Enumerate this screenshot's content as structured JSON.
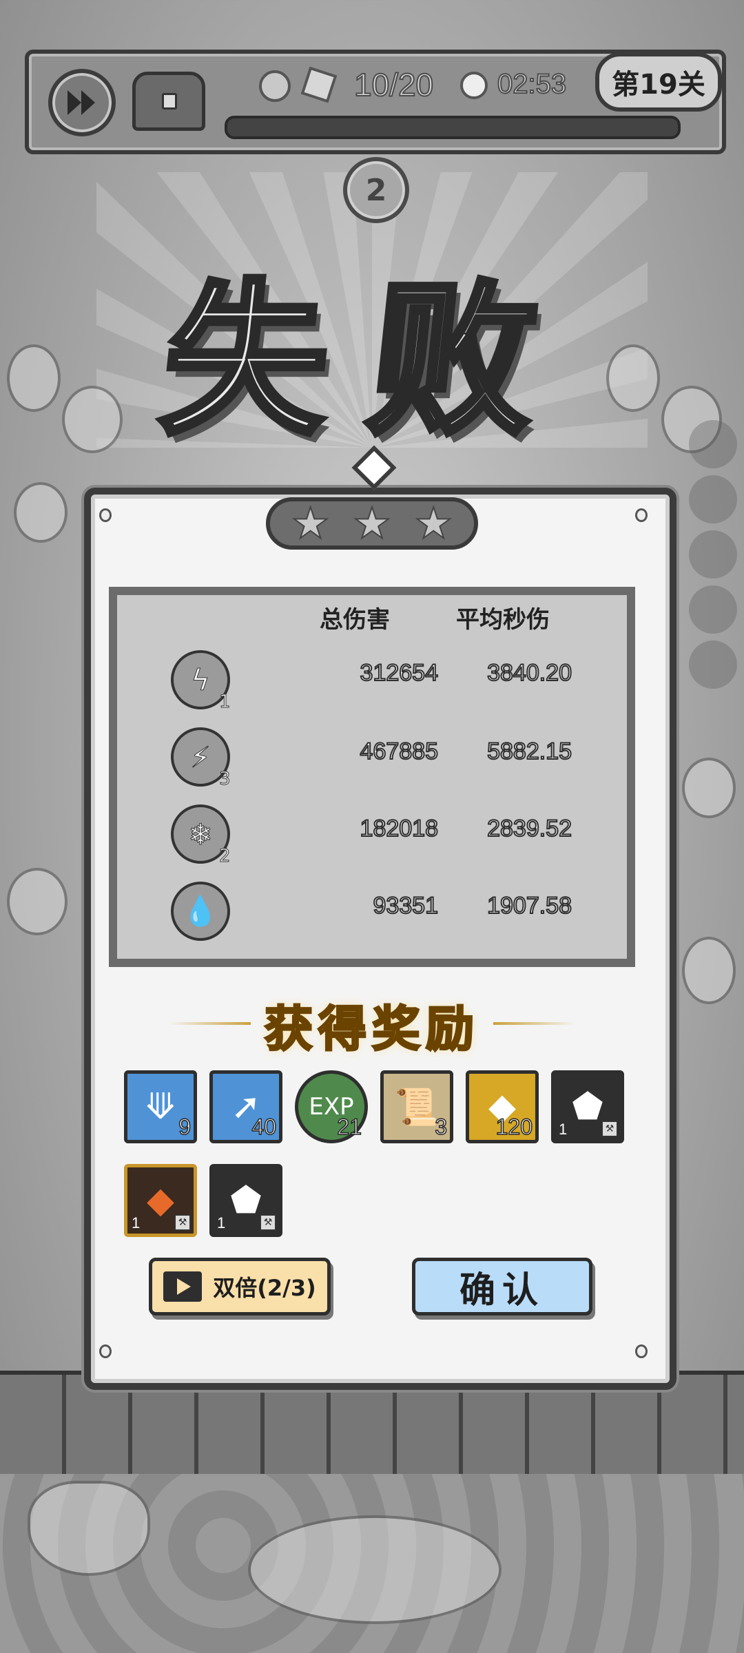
{
  "hud": {
    "resource_count": "10/20",
    "timer": "02:53",
    "stage_label": "第19关",
    "wave_number": "2",
    "progress": 0.0
  },
  "result": {
    "title": "失败",
    "stars_earned": 0,
    "stars_total": 3
  },
  "stats": {
    "header_total": "总伤害",
    "header_dps": "平均秒伤",
    "rows": [
      {
        "icon": "lightning-strike-icon",
        "level": "1",
        "total": "312654",
        "dps": "3840.20"
      },
      {
        "icon": "chain-lightning-icon",
        "level": "3",
        "total": "467885",
        "dps": "5882.15"
      },
      {
        "icon": "ice-crystal-icon",
        "level": "2",
        "total": "182018",
        "dps": "2839.52"
      },
      {
        "icon": "poison-drop-icon",
        "level": "",
        "total": "93351",
        "dps": "1907.58"
      }
    ]
  },
  "rewards": {
    "title": "获得奖励",
    "items": [
      {
        "icon": "drill-card-icon",
        "count": "9",
        "color": "#4f93d6"
      },
      {
        "icon": "spear-card-icon",
        "count": "40",
        "color": "#4f93d6"
      },
      {
        "icon": "exp-orb-icon",
        "label": "EXP",
        "count": "21",
        "color": "#4f8a4c"
      },
      {
        "icon": "scroll-icon",
        "count": "3",
        "color": "#c9b58a"
      },
      {
        "icon": "gold-coin-icon",
        "count": "120",
        "color": "#d6a826"
      },
      {
        "icon": "stone-ore-icon",
        "count": "1",
        "color": "#2f2f2f"
      },
      {
        "icon": "amber-ore-icon",
        "count": "1",
        "color": "#3a2a20"
      },
      {
        "icon": "stone-ore-icon",
        "count": "1",
        "color": "#2f2f2f"
      }
    ]
  },
  "buttons": {
    "double_label": "双倍(2/3)",
    "confirm_label": "确认"
  }
}
